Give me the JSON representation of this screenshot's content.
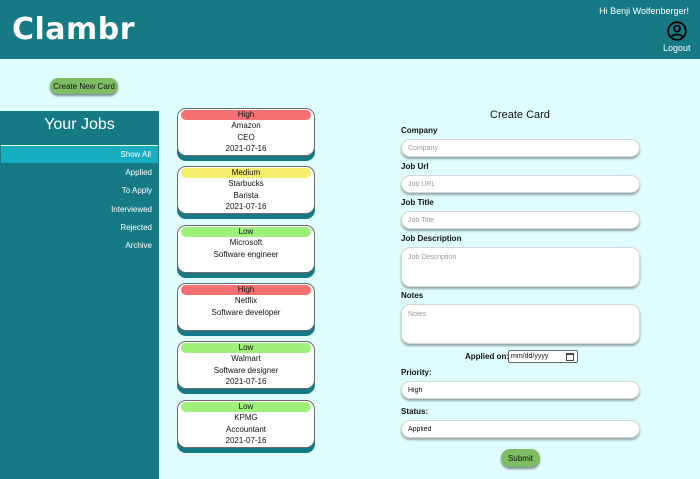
{
  "header": {
    "logo": "Clambr",
    "greeting": "Hi Benji Wolfenberger!",
    "logout": "Logout"
  },
  "create_new_button": "Create New Card",
  "sidebar": {
    "title": "Your Jobs",
    "items": [
      {
        "label": "Show All",
        "active": true
      },
      {
        "label": "Applied"
      },
      {
        "label": "To Apply"
      },
      {
        "label": "Interviewed"
      },
      {
        "label": "Rejected"
      },
      {
        "label": "Archive"
      }
    ]
  },
  "cards": [
    {
      "priority": "High",
      "company": "Amazon",
      "title": "CEO",
      "date": "2021-07-16",
      "color": "#f46f6f"
    },
    {
      "priority": "Medium",
      "company": "Starbucks",
      "title": "Barista",
      "date": "2021-07-16",
      "color": "#f5ee6d"
    },
    {
      "priority": "Low",
      "company": "Microsoft",
      "title": "Software engineer",
      "date": "",
      "color": "#9ef07b"
    },
    {
      "priority": "High",
      "company": "Netflix",
      "title": "Software developer",
      "date": "",
      "color": "#f46f6f"
    },
    {
      "priority": "Low",
      "company": "Walmart",
      "title": "Software designer",
      "date": "2021-07-16",
      "color": "#9ef07b"
    },
    {
      "priority": "Low",
      "company": "KPMG",
      "title": "Accountant",
      "date": "2021-07-16",
      "color": "#9ef07b"
    }
  ],
  "form": {
    "title": "Create Card",
    "company_label": "Company",
    "company_placeholder": "Company",
    "url_label": "Job Url",
    "url_placeholder": "Job URL",
    "job_title_label": "Job Title",
    "job_title_placeholder": "Job Title",
    "desc_label": "Job Description",
    "desc_placeholder": "Job Description",
    "notes_label": "Notes",
    "notes_placeholder": "Notes",
    "applied_label": "Applied on:",
    "date_placeholder": "mm/dd/yyyy",
    "priority_label": "Priority:",
    "priority_value": "High",
    "status_label": "Status:",
    "status_value": "Applied",
    "submit": "Submit"
  },
  "colors": {
    "teal": "#167a85",
    "active": "#16adc0",
    "background": "#e0fdfd",
    "button": "#7dbd64"
  }
}
